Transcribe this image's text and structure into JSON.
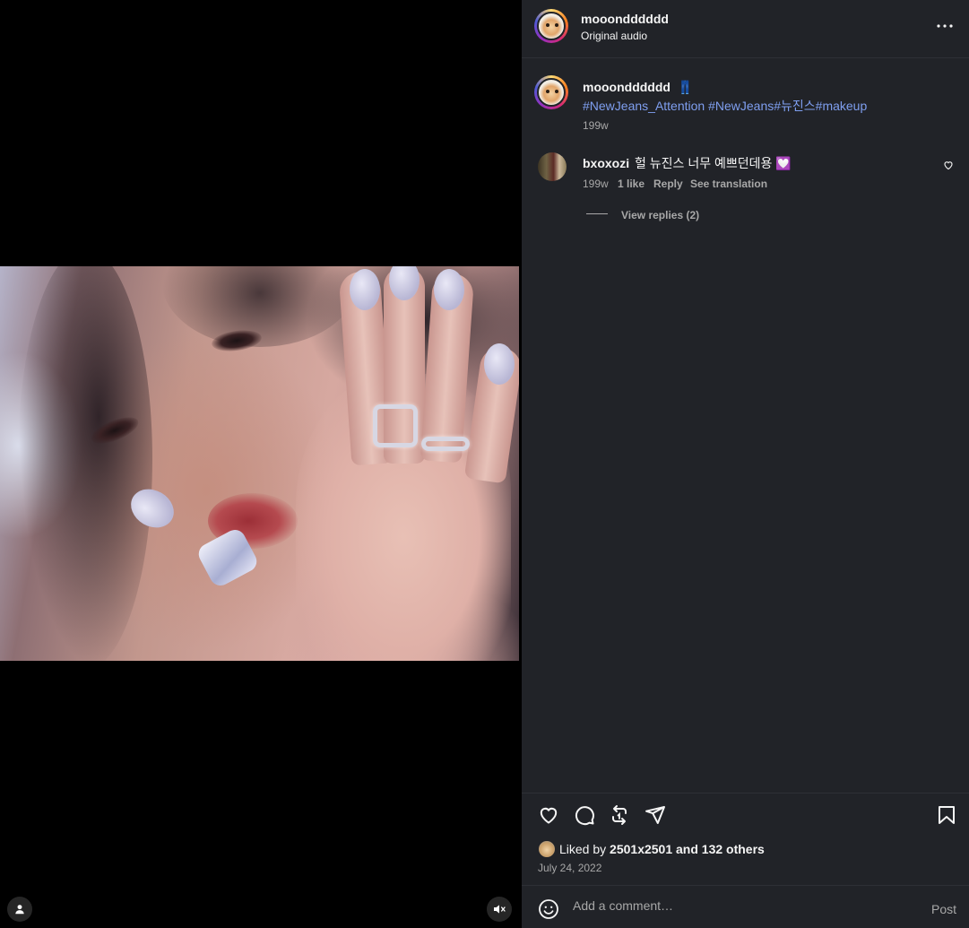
{
  "video": {
    "controls": {
      "user_icon": "user-icon",
      "mute_icon": "muted-speaker-icon"
    }
  },
  "header": {
    "username": "mooondddddd",
    "audio": "Original audio",
    "more_icon": "more-horizontal-icon"
  },
  "caption": {
    "username": "mooondddddd",
    "emoji": "👖",
    "hashtags": "#NewJeans_Attention #NewJeans#뉴진스#makeup",
    "time": "199w"
  },
  "comments": [
    {
      "username": "bxoxozi",
      "text": "헐 뉴진스 너무 예쁘던데용",
      "emoji": "💟",
      "time": "199w",
      "likes": "1 like",
      "reply": "Reply",
      "translate": "See translation",
      "view_replies": "View replies (2)"
    }
  ],
  "actions": {
    "like_icon": "heart-icon",
    "comment_icon": "comment-icon",
    "repost_icon": "repost-icon",
    "share_icon": "send-icon",
    "save_icon": "bookmark-icon"
  },
  "likes": {
    "prefix": "Liked by",
    "user": "2501x2501",
    "and": "and",
    "others": "132 others"
  },
  "date": "July 24, 2022",
  "comment_box": {
    "emoji_icon": "smiley-icon",
    "placeholder": "Add a comment…",
    "post_label": "Post"
  },
  "colors": {
    "sidebar_bg": "#212328",
    "hashtag": "#7f9ff0",
    "muted_text": "#a8a8a8",
    "primary_text": "#f5f5f5"
  }
}
